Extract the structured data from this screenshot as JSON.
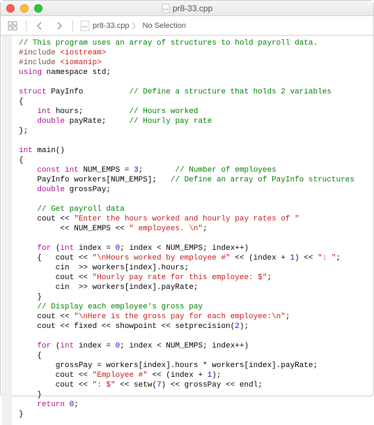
{
  "window": {
    "title": "pr8-33.cpp"
  },
  "breadcrumb": {
    "file": "pr8-33.cpp",
    "selection": "No Selection"
  },
  "code": {
    "l1_comment": "// This program uses an array of structures to hold payroll data.",
    "l2a": "#include ",
    "l2b": "<iostream>",
    "l3a": "#include ",
    "l3b": "<iomanip>",
    "l4a": "using",
    "l4b": " namespace ",
    "l4c": "std",
    "l4d": ";",
    "l6a": "struct",
    "l6b": " PayInfo          ",
    "l6c": "// Define a structure that holds 2 variables",
    "l7": "{",
    "l8a": "    ",
    "l8b": "int",
    "l8c": " hours;          ",
    "l8d": "// Hours worked",
    "l9a": "    ",
    "l9b": "double",
    "l9c": " payRate;     ",
    "l9d": "// Hourly pay rate",
    "l10": "};",
    "l12a": "int",
    "l12b": " main()",
    "l13": "{",
    "l14a": "    ",
    "l14b": "const",
    "l14c": " ",
    "l14d": "int",
    "l14e": " NUM_EMPS = ",
    "l14f": "3",
    "l14g": ";       ",
    "l14h": "// Number of employees",
    "l15a": "    PayInfo workers[NUM_EMPS];   ",
    "l15b": "// Define an array of PayInfo structures",
    "l16a": "    ",
    "l16b": "double",
    "l16c": " grossPay;",
    "l18": "    // Get payroll data",
    "l19a": "    cout << ",
    "l19b": "\"Enter the hours worked and hourly pay rates of \"",
    "l20a": "         << NUM_EMPS << ",
    "l20b": "\" employees. \\n\"",
    "l20c": ";",
    "l22a": "    ",
    "l22b": "for",
    "l22c": " (",
    "l22d": "int",
    "l22e": " index = ",
    "l22f": "0",
    "l22g": "; index < NUM_EMPS; index++)",
    "l23a": "    {   cout << ",
    "l23b": "\"\\nHours worked by employee #\"",
    "l23c": " << (index + ",
    "l23d": "1",
    "l23e": ") << ",
    "l23f": "\": \"",
    "l23g": ";",
    "l24": "        cin  >> workers[index].hours;",
    "l25a": "        cout << ",
    "l25b": "\"Hourly pay rate for this employee: $\"",
    "l25c": ";",
    "l26": "        cin  >> workers[index].payRate;",
    "l27": "    }",
    "l28": "    // Display each employee's gross pay",
    "l29a": "    cout << ",
    "l29b": "\"\\nHere is the gross pay for each employee:\\n\"",
    "l29c": ";",
    "l30a": "    cout << fixed << showpoint << setprecision(",
    "l30b": "2",
    "l30c": ");",
    "l32a": "    ",
    "l32b": "for",
    "l32c": " (",
    "l32d": "int",
    "l32e": " index = ",
    "l32f": "0",
    "l32g": "; index < NUM_EMPS; index++)",
    "l33": "    {",
    "l34": "        grossPay = workers[index].hours * workers[index].payRate;",
    "l35a": "        cout << ",
    "l35b": "\"Employee #\"",
    "l35c": " << (index + ",
    "l35d": "1",
    "l35e": ");",
    "l36a": "        cout << ",
    "l36b": "\": $\"",
    "l36c": " << setw(",
    "l36d": "7",
    "l36e": ") << grossPay << endl;",
    "l37": "    }",
    "l38a": "    ",
    "l38b": "return",
    "l38c": " ",
    "l38d": "0",
    "l38e": ";",
    "l39": "}"
  }
}
